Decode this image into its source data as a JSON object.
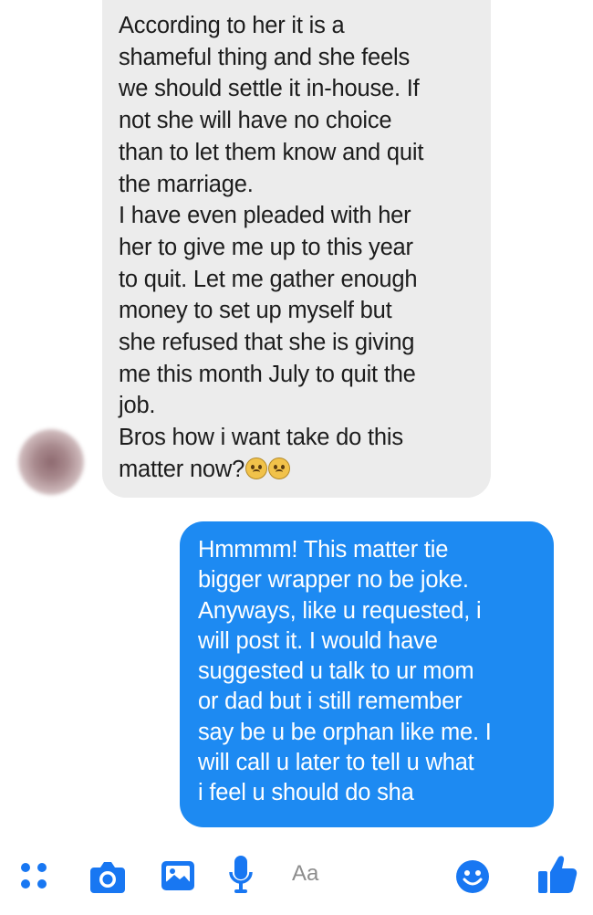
{
  "conversation": {
    "incoming_message": "According to her it is a\nshameful thing and she feels\nwe should settle it in-house. If\nnot she will have no choice\nthan to let them know and quit\nthe marriage.\nI have even pleaded with her\nher to give me up to this year\nto quit. Let me gather enough\nmoney to set up myself but\nshe refused that she is giving\nme this month July to quit the\njob.\nBros how i want take do this\nmatter now?",
    "incoming_emoji": "worried-face-emoji x2",
    "outgoing_message": "Hmmmm! This matter tie\nbigger wrapper no be joke.\nAnyways, like u requested, i\nwill post it. I would have\nsuggested u talk to ur mom\nor dad but i still remember\nsay be u be orphan like me. I\nwill call u later to tell u what\ni feel u should do sha"
  },
  "composer": {
    "input_placeholder": "Aa",
    "icons": [
      "more-options-icon",
      "camera-icon",
      "gallery-icon",
      "microphone-icon",
      "emoji-icon",
      "thumbs-up-icon"
    ]
  },
  "colors": {
    "incoming_bubble": "#ececec",
    "outgoing_bubble": "#1d8af2",
    "accent": "#1877f2"
  }
}
